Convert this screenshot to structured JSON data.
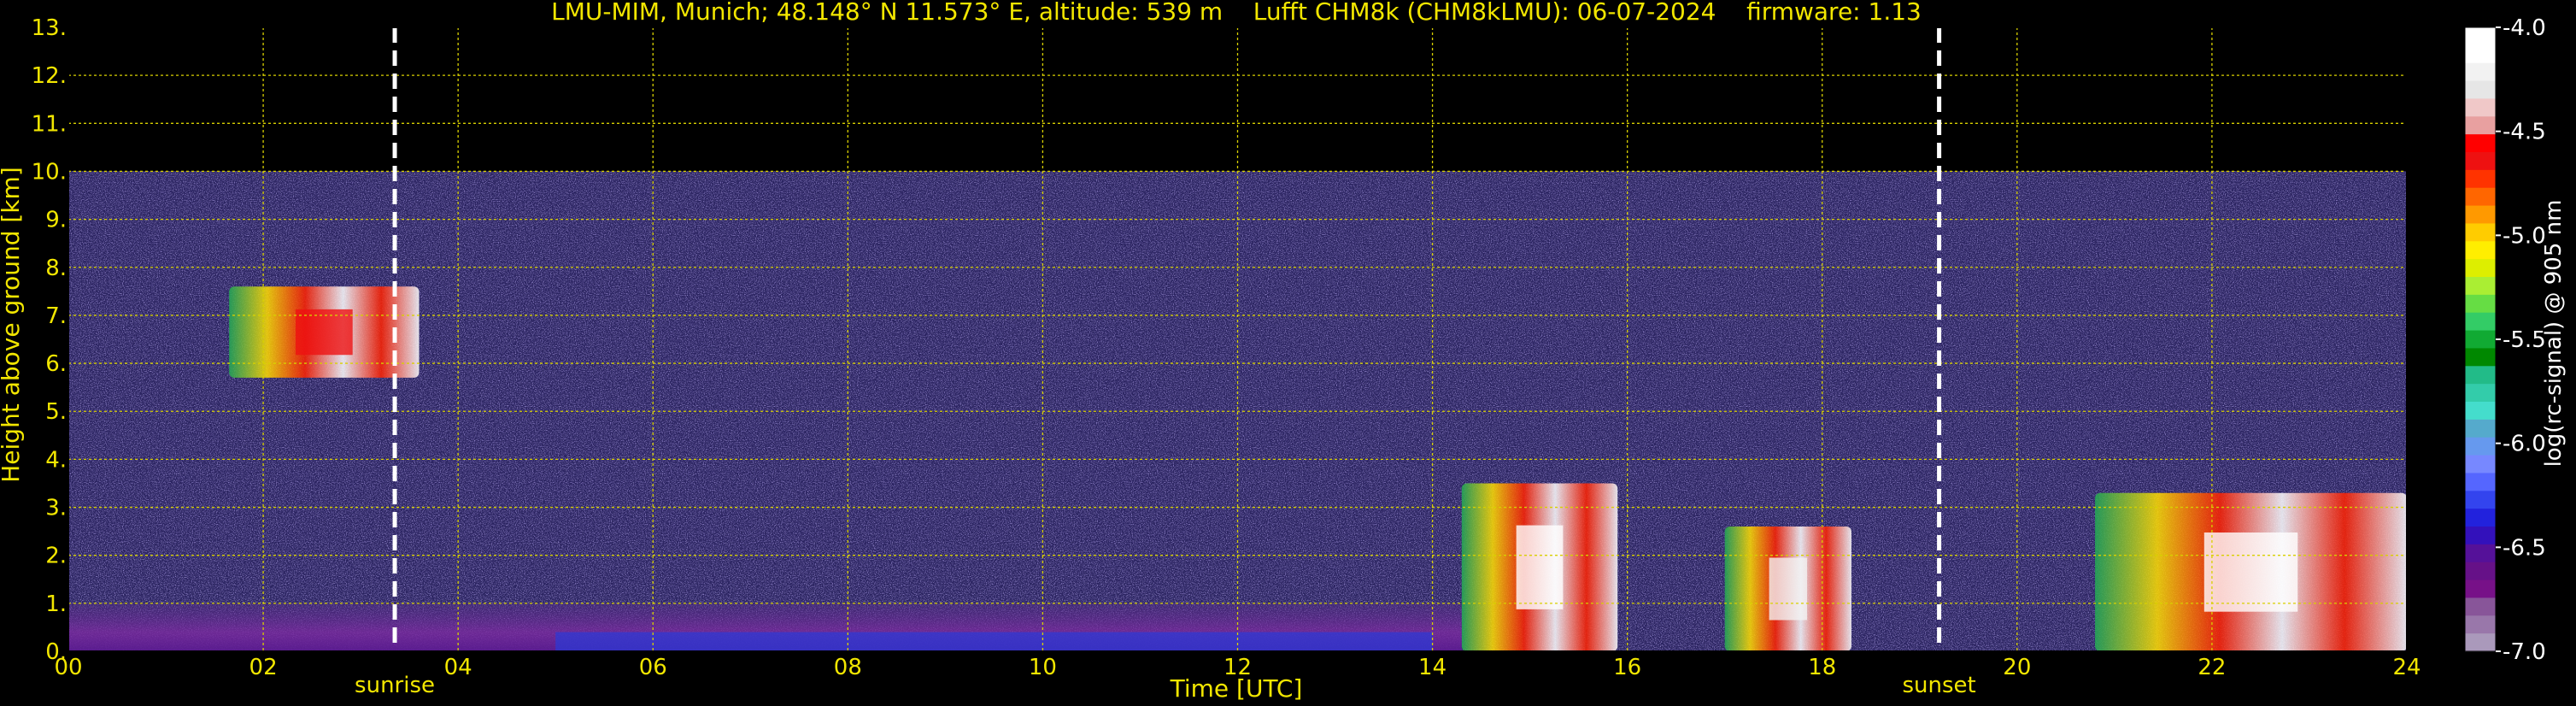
{
  "chart_data": {
    "type": "heatmap",
    "title": "LMU-MIM, Munich; 48.148° N 11.573° E, altitude: 539 m    Lufft CHM8k (CHM8kLMU): 06-07-2024    firmware: 1.13",
    "xlabel": "Time [UTC]",
    "ylabel": "Height above ground [km]",
    "xlim": [
      0,
      24
    ],
    "ylim": [
      0,
      13
    ],
    "x_ticks": [
      "00",
      "02",
      "04",
      "06",
      "08",
      "10",
      "12",
      "14",
      "16",
      "18",
      "20",
      "22",
      "24"
    ],
    "x_tick_values": [
      0,
      2,
      4,
      6,
      8,
      10,
      12,
      14,
      16,
      18,
      20,
      22,
      24
    ],
    "y_ticks": [
      "0.",
      "1.",
      "2.",
      "3.",
      "4.",
      "5.",
      "6.",
      "7.",
      "8.",
      "9.",
      "10.",
      "11.",
      "12.",
      "13."
    ],
    "y_tick_values": [
      0,
      1,
      2,
      3,
      4,
      5,
      6,
      7,
      8,
      9,
      10,
      11,
      12,
      13
    ],
    "grid": true,
    "data_top_km": 10,
    "markers": [
      {
        "label": "sunrise",
        "time": 3.35
      },
      {
        "label": "sunset",
        "time": 19.2
      }
    ],
    "features": [
      {
        "kind": "cloud",
        "t_start": 1.65,
        "t_end": 3.6,
        "h_min": 5.7,
        "h_max": 7.6,
        "level": -4.6
      },
      {
        "kind": "cloud",
        "t_start": 14.3,
        "t_end": 15.9,
        "h_min": 0.0,
        "h_max": 3.5,
        "level": -4.1
      },
      {
        "kind": "cloud",
        "t_start": 17.0,
        "t_end": 18.3,
        "h_min": 0.0,
        "h_max": 2.6,
        "level": -4.2
      },
      {
        "kind": "cloud",
        "t_start": 20.8,
        "t_end": 24.0,
        "h_min": 0.0,
        "h_max": 3.3,
        "level": -4.1
      },
      {
        "kind": "boundary_layer",
        "t_start": 0.0,
        "t_end": 14.3,
        "h_min": 0.0,
        "h_max": 1.0,
        "level": -6.6
      }
    ],
    "colorbar": {
      "label": "log(rc-signal) @ 905 nm",
      "min": -7.0,
      "max": -4.0,
      "ticks": [
        "-4.0",
        "-4.5",
        "-5.0",
        "-5.5",
        "-6.0",
        "-6.5",
        "-7.0"
      ],
      "tick_values": [
        -4.0,
        -4.5,
        -5.0,
        -5.5,
        -6.0,
        -6.5,
        -7.0
      ],
      "colors": [
        "#ffffff",
        "#ffffff",
        "#f2f2f2",
        "#e6e6e6",
        "#f0c8c8",
        "#e8a0a0",
        "#ff0000",
        "#ee1111",
        "#ff3300",
        "#ff6600",
        "#ff9900",
        "#ffcc00",
        "#ffee00",
        "#ddee00",
        "#aaee33",
        "#66dd44",
        "#33cc66",
        "#11aa33",
        "#008800",
        "#22bb88",
        "#33ccaa",
        "#44ddcc",
        "#55aacc",
        "#6699ee",
        "#7788ff",
        "#5566ff",
        "#3344ee",
        "#2222dd",
        "#3311bb",
        "#551199",
        "#661188",
        "#771188",
        "#885599",
        "#9977aa",
        "#aa99bb"
      ]
    }
  }
}
